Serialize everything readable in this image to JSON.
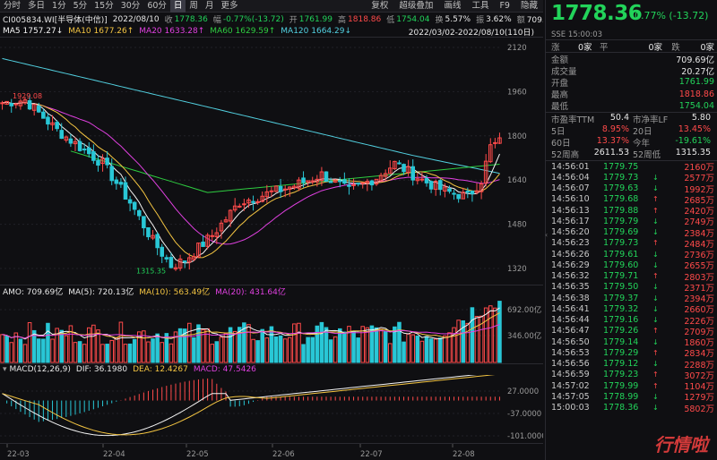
{
  "toolbar": {
    "periods": [
      "分时",
      "多日",
      "1分",
      "5分",
      "15分",
      "30分",
      "60分",
      "日",
      "周",
      "月",
      "更多"
    ],
    "active_period": "日",
    "tools": [
      "复权",
      "超级叠加",
      "画线",
      "工具",
      "F9",
      "隐藏"
    ]
  },
  "info": {
    "code": "CI005834.WI[半导体(中信)]",
    "date": "2022/08/10",
    "close_label": "收",
    "close": "1778.36",
    "amp_label": "幅",
    "change": "-0.77%(-13.72)",
    "open_label": "开",
    "open": "1761.99",
    "high_label": "高",
    "high": "1818.86",
    "low_label": "低",
    "low": "1754.04",
    "turnover_label": "换",
    "turnover": "5.57%",
    "swing_label": "振",
    "swing": "3.62%",
    "amount_label": "额",
    "amount": "709.69亿"
  },
  "ma_row": {
    "ma5": "MA5  1757.27↓",
    "ma10": "MA10  1677.26↑",
    "ma20": "MA20  1633.28↑",
    "ma60": "MA60  1629.59↑",
    "ma120": "MA120  1664.29↓",
    "range": "2022/03/02-2022/08/10(110日)"
  },
  "price_axis": [
    "2120",
    "1960",
    "1800",
    "1640",
    "1480",
    "1320"
  ],
  "annotations": {
    "high_mark": "1929.08",
    "low_mark": "1315.35"
  },
  "amo_row": {
    "amo": "AMO: 709.69亿",
    "ma5": "MA(5): 720.13亿",
    "ma10": "MA(10): 563.49亿",
    "ma20": "MA(20): 431.64亿"
  },
  "vol_axis": [
    "692.00亿",
    "346.00亿"
  ],
  "macd_row": {
    "title": "MACD(12,26,9)",
    "dif": "DIF: 36.1980",
    "dea": "DEA: 12.4267",
    "macd": "MACD: 47.5426"
  },
  "macd_axis": [
    "27.0000",
    "-37.0000",
    "-101.0000"
  ],
  "date_axis": [
    "22-03",
    "22-04",
    "22-05",
    "22-06",
    "22-07",
    "22-08"
  ],
  "quote": {
    "price": "1778.36",
    "change": "-0.77%",
    "change_abs": "(-13.72)",
    "sub": "SSE  15:00:03",
    "adv_label": "涨",
    "adv": "0家",
    "flat_label": "平",
    "flat": "0家",
    "dec_label": "跌",
    "dec": "0家",
    "rows": [
      {
        "k": "金额",
        "v": "709.69亿",
        "c": "white"
      },
      {
        "k": "成交量",
        "v": "20.27亿",
        "c": "white"
      },
      {
        "k": "开盘",
        "v": "1761.99",
        "c": "green"
      },
      {
        "k": "最高",
        "v": "1818.86",
        "c": "red"
      },
      {
        "k": "最低",
        "v": "1754.04",
        "c": "green"
      }
    ],
    "pairs": [
      [
        {
          "k": "市盈率TTM",
          "v": "50.4",
          "c": "white"
        },
        {
          "k": "市净率LF",
          "v": "5.80",
          "c": "white"
        }
      ],
      [
        {
          "k": "5日",
          "v": "8.95%",
          "c": "red"
        },
        {
          "k": "20日",
          "v": "13.45%",
          "c": "red"
        }
      ],
      [
        {
          "k": "60日",
          "v": "13.37%",
          "c": "red"
        },
        {
          "k": "今年",
          "v": "-19.61%",
          "c": "green"
        }
      ],
      [
        {
          "k": "52周高",
          "v": "2611.53",
          "c": "white"
        },
        {
          "k": "52周低",
          "v": "1315.35",
          "c": "white"
        }
      ]
    ],
    "ticks": [
      {
        "t": "14:56:01",
        "p": "1779.75",
        "d": "",
        "v": "2160万"
      },
      {
        "t": "14:56:04",
        "p": "1779.73",
        "d": "↓",
        "v": "2577万"
      },
      {
        "t": "14:56:07",
        "p": "1779.63",
        "d": "↓",
        "v": "1992万"
      },
      {
        "t": "14:56:10",
        "p": "1779.68",
        "d": "↑",
        "v": "2685万"
      },
      {
        "t": "14:56:13",
        "p": "1779.88",
        "d": "↑",
        "v": "2420万"
      },
      {
        "t": "14:56:17",
        "p": "1779.79",
        "d": "↓",
        "v": "2749万"
      },
      {
        "t": "14:56:20",
        "p": "1779.69",
        "d": "↓",
        "v": "2384万"
      },
      {
        "t": "14:56:23",
        "p": "1779.73",
        "d": "↑",
        "v": "2484万"
      },
      {
        "t": "14:56:26",
        "p": "1779.61",
        "d": "↓",
        "v": "2736万"
      },
      {
        "t": "14:56:29",
        "p": "1779.60",
        "d": "↓",
        "v": "2655万"
      },
      {
        "t": "14:56:32",
        "p": "1779.71",
        "d": "↑",
        "v": "2803万"
      },
      {
        "t": "14:56:35",
        "p": "1779.50",
        "d": "↓",
        "v": "2371万"
      },
      {
        "t": "14:56:38",
        "p": "1779.37",
        "d": "↓",
        "v": "2394万"
      },
      {
        "t": "14:56:41",
        "p": "1779.32",
        "d": "↓",
        "v": "2660万"
      },
      {
        "t": "14:56:44",
        "p": "1779.16",
        "d": "↓",
        "v": "2226万"
      },
      {
        "t": "14:56:47",
        "p": "1779.26",
        "d": "↑",
        "v": "2709万"
      },
      {
        "t": "14:56:50",
        "p": "1779.14",
        "d": "↓",
        "v": "1860万"
      },
      {
        "t": "14:56:53",
        "p": "1779.29",
        "d": "↑",
        "v": "2834万"
      },
      {
        "t": "14:56:56",
        "p": "1779.12",
        "d": "↓",
        "v": "2288万"
      },
      {
        "t": "14:56:59",
        "p": "1779.23",
        "d": "↑",
        "v": "3072万"
      },
      {
        "t": "14:57:02",
        "p": "1779.99",
        "d": "↑",
        "v": "1104万"
      },
      {
        "t": "14:57:05",
        "p": "1778.99",
        "d": "↓",
        "v": "1279万"
      },
      {
        "t": "15:00:03",
        "p": "1778.36",
        "d": "↓",
        "v": "5802万"
      }
    ]
  },
  "watermark": "行情啦"
}
